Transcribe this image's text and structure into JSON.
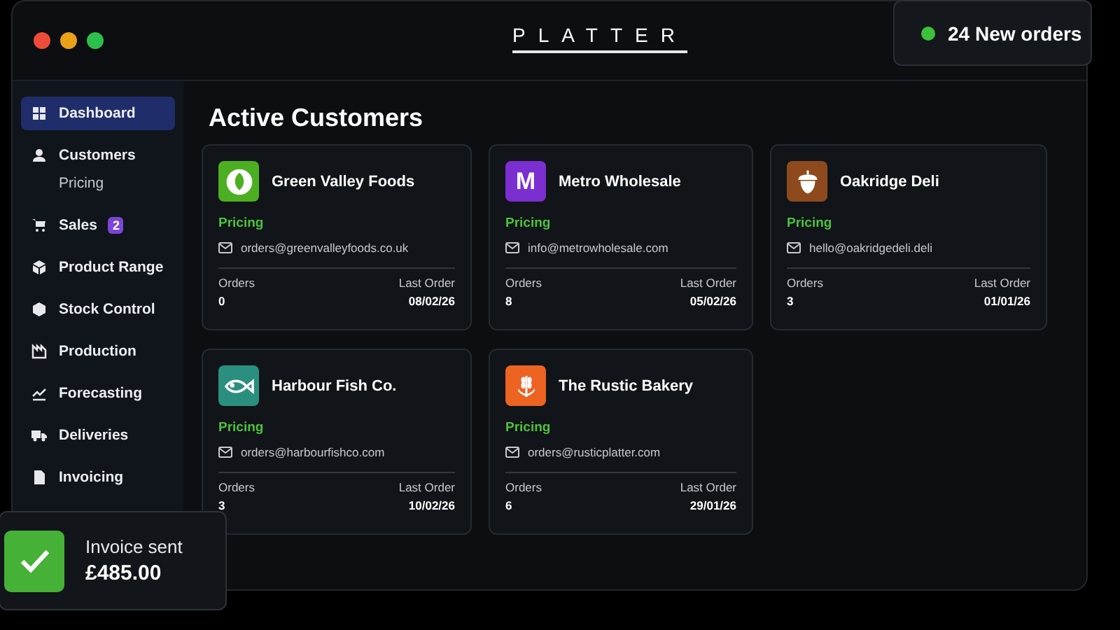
{
  "window": {
    "brand": "PLATTER",
    "traffic_lights": [
      {
        "color": "#ee4b3b"
      },
      {
        "color": "#e9a117"
      },
      {
        "color": "#2dbf4c"
      }
    ]
  },
  "sidebar": {
    "items": [
      {
        "label": "Dashboard",
        "selected": true
      },
      {
        "label": "Customers",
        "selected": false,
        "children": [
          {
            "label": "Pricing",
            "selected": false
          }
        ]
      },
      {
        "label": "Sales",
        "selected": false,
        "badge": "2"
      },
      {
        "label": "Product Range",
        "selected": false
      },
      {
        "label": "Stock Control",
        "selected": false
      },
      {
        "label": "Production",
        "selected": false
      },
      {
        "label": "Forecasting",
        "selected": false
      },
      {
        "label": "Deliveries",
        "selected": false
      },
      {
        "label": "Invoicing",
        "selected": false
      }
    ]
  },
  "main": {
    "title": "Active Customers",
    "customers": [
      {
        "name": "Green Valley Foods",
        "kind": "leaf",
        "color": "#4caf22",
        "pricing": "Pricing",
        "email": "orders@greenvalleyfoods.co.uk",
        "orders_label": "Orders",
        "orders": "0",
        "last_order_label": "Last Order",
        "last_order": "08/02/26"
      },
      {
        "name": "Metro Wholesale",
        "kind": "letter",
        "logo_text": "M",
        "color": "#7b2fd0",
        "pricing": "Pricing",
        "email": "info@metrowholesale.com",
        "orders_label": "Orders",
        "orders": "8",
        "last_order_label": "Last Order",
        "last_order": "05/02/26"
      },
      {
        "name": "Oakridge Deli",
        "kind": "acorn",
        "color": "#8e4a1c",
        "pricing": "Pricing",
        "email": "hello@oakridgedeli.deli",
        "orders_label": "Orders",
        "orders": "3",
        "last_order_label": "Last Order",
        "last_order": "01/01/26"
      },
      {
        "name": "Harbour Fish Co.",
        "kind": "fish",
        "color": "#2b8f80",
        "pricing": "Pricing",
        "email": "orders@harbourfishco.com",
        "orders_label": "Orders",
        "orders": "3",
        "last_order_label": "Last Order",
        "last_order": "10/02/26"
      },
      {
        "name": "The Rustic Bakery",
        "kind": "wheat",
        "color": "#ec6322",
        "pricing": "Pricing",
        "email": "orders@rusticplatter.com",
        "orders_label": "Orders",
        "orders": "6",
        "last_order_label": "Last Order",
        "last_order": "29/01/26"
      }
    ]
  },
  "orders_toast": {
    "text": "24 New orders",
    "color": "#3cc13b"
  },
  "invoice_toast": {
    "title": "Invoice sent",
    "amount": "£485.00"
  }
}
